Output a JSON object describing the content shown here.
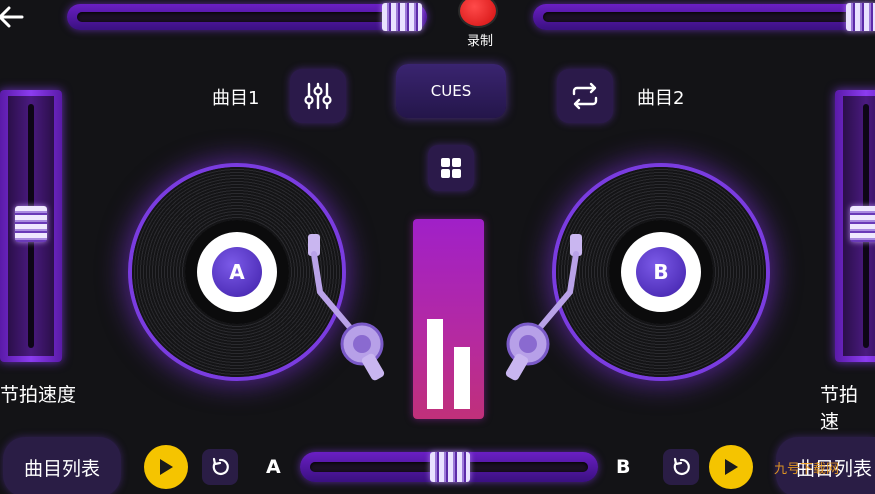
{
  "top": {
    "record_label": "录制",
    "left_fader_value": 0.9,
    "right_fader_value": 0.97
  },
  "header": {
    "track1_label": "曲目1",
    "track2_label": "曲目2",
    "cues_label": "CUES"
  },
  "decks": {
    "left_label": "A",
    "right_label": "B"
  },
  "side": {
    "left_tempo_label": "节拍速度",
    "right_tempo_label": "节拍速"
  },
  "bottom": {
    "playlist_left_label": "曲目列表",
    "playlist_right_label": "曲目列表",
    "deck_a_label": "A",
    "deck_b_label": "B",
    "crossfader_value": 0.5
  },
  "watermark": "九号下载网",
  "colors": {
    "accent_purple": "#7a3ce0",
    "play_yellow": "#f5c400",
    "record_red": "#e01515",
    "meter_magenta": "#b52aa0"
  },
  "icons": {
    "back": "arrow-left-icon",
    "equalizer": "sliders-icon",
    "repeat": "repeat-icon",
    "grid": "grid-icon",
    "play": "play-icon",
    "reset": "rotate-ccw-icon"
  }
}
